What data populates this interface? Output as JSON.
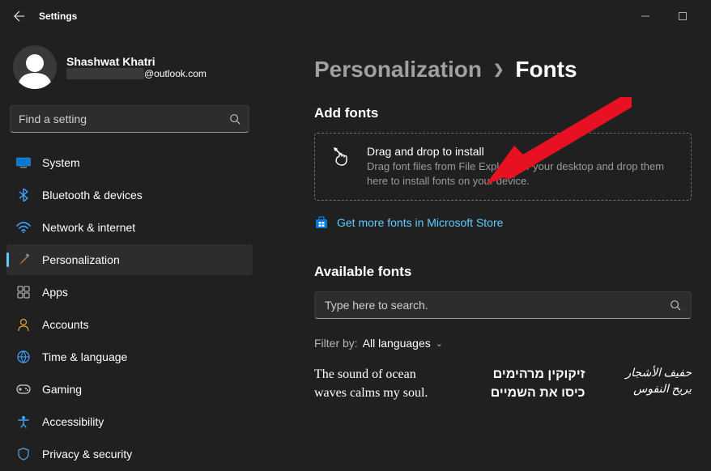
{
  "window": {
    "title": "Settings"
  },
  "profile": {
    "name": "Shashwat Khatri",
    "email_domain": "@outlook.com"
  },
  "search": {
    "placeholder": "Find a setting"
  },
  "sidebar": {
    "items": [
      {
        "label": "System",
        "icon": "system"
      },
      {
        "label": "Bluetooth & devices",
        "icon": "bluetooth"
      },
      {
        "label": "Network & internet",
        "icon": "wifi"
      },
      {
        "label": "Personalization",
        "icon": "brush",
        "active": true
      },
      {
        "label": "Apps",
        "icon": "apps"
      },
      {
        "label": "Accounts",
        "icon": "person"
      },
      {
        "label": "Time & language",
        "icon": "globe"
      },
      {
        "label": "Gaming",
        "icon": "game"
      },
      {
        "label": "Accessibility",
        "icon": "access"
      },
      {
        "label": "Privacy & security",
        "icon": "shield"
      }
    ]
  },
  "breadcrumb": {
    "parent": "Personalization",
    "current": "Fonts"
  },
  "addfonts": {
    "title": "Add fonts",
    "drop_title": "Drag and drop to install",
    "drop_sub": "Drag font files from File Explorer or your desktop and drop them here to install fonts on your device.",
    "store_link": "Get more fonts in Microsoft Store"
  },
  "available": {
    "title": "Available fonts",
    "search_placeholder": "Type here to search.",
    "filter_label": "Filter by:",
    "filter_value": "All languages",
    "previews": [
      "The sound of ocean waves calms my soul.",
      "זיקוקין מרהימים כיסו את השמיים",
      "حفيف الأشجار يريح النفوس"
    ]
  }
}
